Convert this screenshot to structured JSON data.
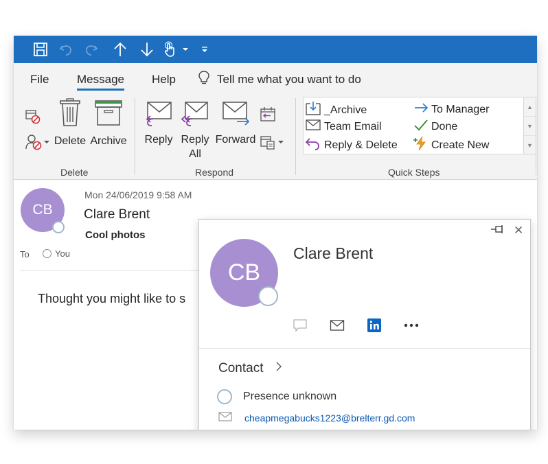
{
  "colors": {
    "accent": "#1e6fbf",
    "avatar": "#a88fd1",
    "presence_ring": "#9fb8cc",
    "link": "#0a58b4",
    "arrow_purple": "#8b3aa8",
    "arrow_blue": "#2b7fd2",
    "check_green": "#2e8b36",
    "linkedin_blue": "#0a66c2"
  },
  "qat": {
    "icons": [
      "save-icon",
      "undo-icon",
      "redo-icon",
      "previous-item-icon",
      "next-item-icon",
      "touch-mode-icon",
      "touch-dropdown-icon",
      "customize-qat-icon"
    ]
  },
  "tabs": [
    {
      "label": "File",
      "active": false
    },
    {
      "label": "Message",
      "active": true
    },
    {
      "label": "Help",
      "active": false
    }
  ],
  "tellme": {
    "label": "Tell me what you want to do",
    "icon": "lightbulb-icon"
  },
  "ribbon": {
    "delete_group": {
      "label": "Delete",
      "buttons": [
        {
          "label": "Delete",
          "icon": "trash-icon"
        },
        {
          "label": "Archive",
          "icon": "archive-box-icon"
        }
      ],
      "small_icons": [
        "ignore-icon",
        "block-sender-icon"
      ]
    },
    "respond_group": {
      "label": "Respond",
      "buttons": [
        {
          "label": "Reply",
          "icon": "reply-icon"
        },
        {
          "label_line1": "Reply",
          "label_line2": "All",
          "icon": "reply-all-icon"
        },
        {
          "label": "Forward",
          "icon": "forward-icon"
        }
      ],
      "small_icons": [
        "meeting-reply-icon",
        "more-respond-icon"
      ]
    },
    "quicksteps_group": {
      "label": "Quick Steps",
      "items": [
        {
          "label": "_Archive",
          "icon": "archive-folder-icon"
        },
        {
          "label": "To Manager",
          "icon": "arrow-right-icon"
        },
        {
          "label": "Team Email",
          "icon": "envelope-icon"
        },
        {
          "label": "Done",
          "icon": "checkmark-icon"
        },
        {
          "label": "Reply & Delete",
          "icon": "reply-arrow-icon"
        },
        {
          "label": "Create New",
          "icon": "lightning-icon"
        }
      ]
    }
  },
  "message": {
    "avatar_initials": "CB",
    "date": "Mon 24/06/2019 9:58 AM",
    "from": "Clare Brent",
    "subject": "Cool photos",
    "to_label": "To",
    "to_value": "You",
    "body": "Thought you might like to s"
  },
  "contact_card": {
    "initials": "CB",
    "name": "Clare Brent",
    "actions": [
      "chat-icon",
      "mail-icon",
      "linkedin-icon",
      "more-icon"
    ],
    "section_label": "Contact",
    "presence": "Presence unknown",
    "email": "cheapmegabucks1223@brelterr.gd.com"
  }
}
